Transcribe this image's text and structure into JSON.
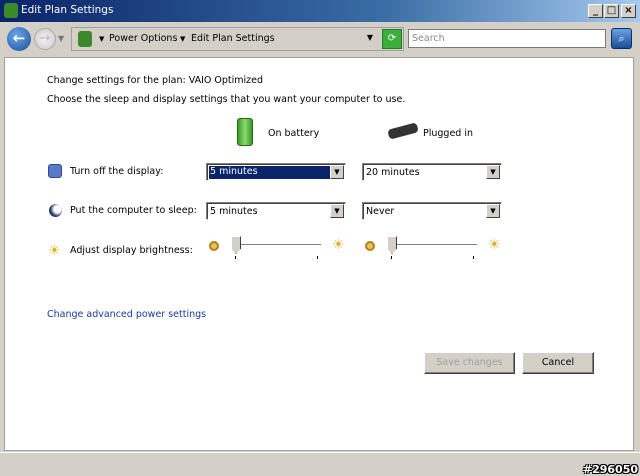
{
  "window": {
    "title": "Edit Plan Settings"
  },
  "nav": {
    "breadcrumb": [
      "Power Options",
      "Edit Plan Settings"
    ],
    "search_placeholder": "Search"
  },
  "main": {
    "plan_line": "Change settings for the plan: VAIO Optimized",
    "subtitle": "Choose the sleep and display settings that you want your computer to use.",
    "col_battery": "On battery",
    "col_plugged": "Plugged in",
    "rows": [
      {
        "label": "Turn off the display:",
        "battery": "5 minutes",
        "plugged": "20 minutes"
      },
      {
        "label": "Put the computer to sleep:",
        "battery": "5 minutes",
        "plugged": "Never"
      },
      {
        "label": "Adjust display brightness:",
        "battery_level": 0.0,
        "plugged_level": 0.0
      }
    ],
    "advanced_link": "Change advanced power settings",
    "save_label": "Save changes",
    "cancel_label": "Cancel"
  },
  "watermark": "#296050"
}
